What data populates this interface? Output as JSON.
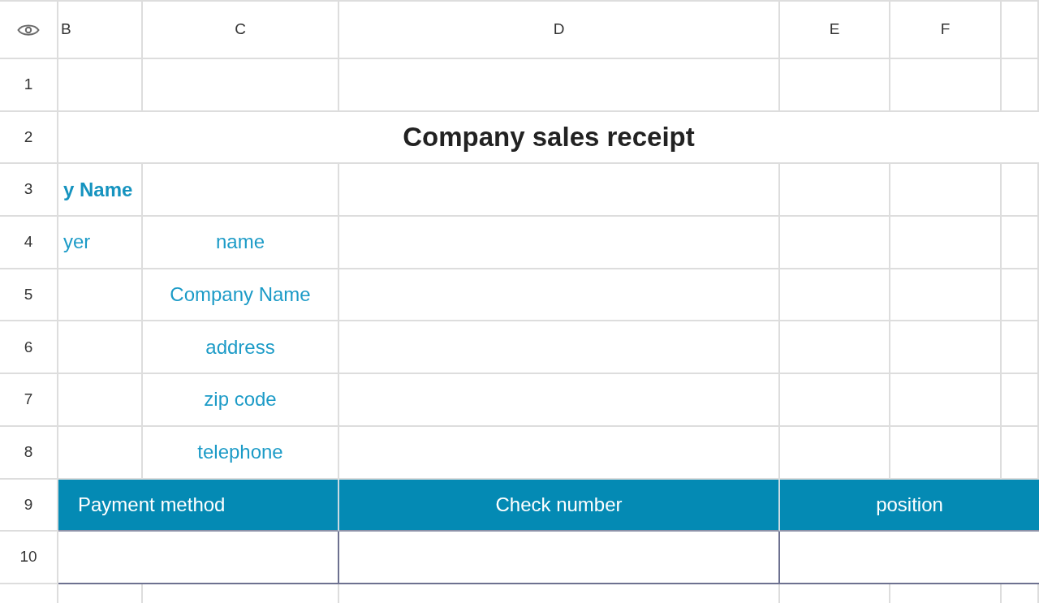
{
  "columns": [
    {
      "label": "B"
    },
    {
      "label": "C"
    },
    {
      "label": "D"
    },
    {
      "label": "E"
    },
    {
      "label": "F"
    }
  ],
  "rows": [
    {
      "number": "1",
      "kind": "blank"
    },
    {
      "number": "2",
      "kind": "title",
      "text": "Company sales receipt"
    },
    {
      "number": "3",
      "kind": "fields",
      "column_b": {
        "text": "y Name",
        "bold": true
      }
    },
    {
      "number": "4",
      "kind": "fields",
      "column_b": {
        "text": "yer",
        "bold": false
      },
      "column_c": {
        "text": "name"
      }
    },
    {
      "number": "5",
      "kind": "fields",
      "column_c": {
        "text": "Company Name"
      }
    },
    {
      "number": "6",
      "kind": "fields",
      "column_c": {
        "text": "address"
      }
    },
    {
      "number": "7",
      "kind": "fields",
      "column_c": {
        "text": "zip code"
      }
    },
    {
      "number": "8",
      "kind": "fields",
      "column_c": {
        "text": "telephone"
      }
    },
    {
      "number": "9",
      "kind": "band",
      "cells": [
        "Payment method",
        "Check number",
        "position"
      ]
    },
    {
      "number": "10",
      "kind": "entry"
    }
  ]
}
